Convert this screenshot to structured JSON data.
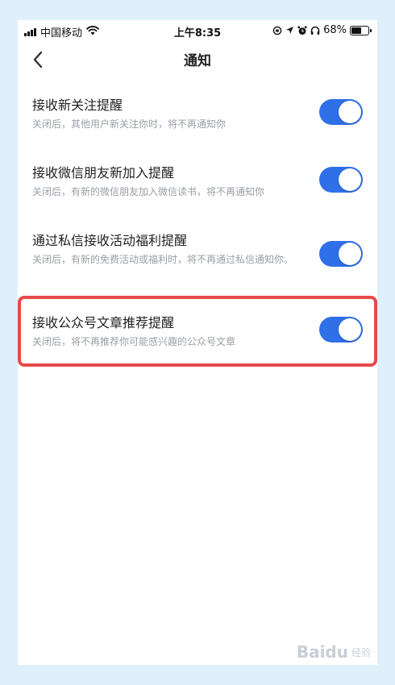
{
  "status_bar": {
    "carrier": "中国移动",
    "time": "上午8:35",
    "battery": "68%",
    "battery_level": 0.68
  },
  "nav": {
    "title": "通知"
  },
  "settings": [
    {
      "title": "接收新关注提醒",
      "desc": "关闭后，其他用户新关注你时，将不再通知你",
      "enabled": true
    },
    {
      "title": "接收微信朋友新加入提醒",
      "desc": "关闭后，有新的微信朋友加入微信读书，将不再通知你",
      "enabled": true
    },
    {
      "title": "通过私信接收活动福利提醒",
      "desc": "关闭后，有新的免费活动或福利时，将不再通过私信通知你。",
      "enabled": true
    },
    {
      "title": "接收公众号文章推荐提醒",
      "desc": "关闭后，将不再推荐你可能感兴趣的公众号文章",
      "enabled": true
    }
  ],
  "watermark": {
    "text": "Baidu",
    "sub": "经验"
  },
  "colors": {
    "toggle_on": "#2f6fe8",
    "highlight": "#e84a4a",
    "background": "#dff0fb"
  }
}
